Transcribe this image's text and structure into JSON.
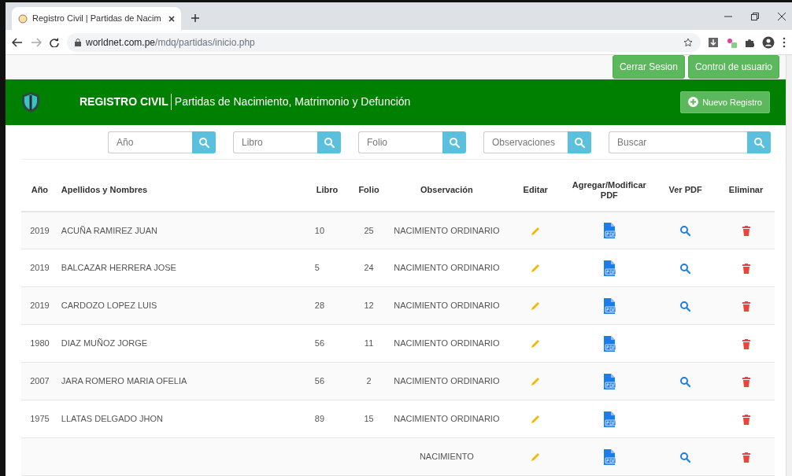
{
  "browser": {
    "tab_title": "Registro Civil | Partidas de Nacim",
    "url_host": "worldnet.com.pe",
    "url_path": "/mdq/partidas/inicio.php"
  },
  "top_buttons": [
    "Cerrar Sesion",
    "Control de usuario"
  ],
  "header": {
    "brand": "REGISTRO CIVIL",
    "subtitle": "Partidas de Nacimiento, Matrimonio y Defunción",
    "new_button": "Nuevo Registro"
  },
  "filters": [
    {
      "placeholder": "Año"
    },
    {
      "placeholder": "Libro"
    },
    {
      "placeholder": "Folio"
    },
    {
      "placeholder": "Observaciones"
    },
    {
      "placeholder": "Buscar"
    }
  ],
  "table": {
    "columns": [
      "Año",
      "Apellidos y Nombres",
      "Libro",
      "Folio",
      "Observación",
      "Editar",
      "Agregar/Modificar PDF",
      "Ver PDF",
      "Eliminar"
    ],
    "rows": [
      {
        "year": "2019",
        "name": "ACUÑA RAMIREZ JUAN",
        "libro": "10",
        "folio": "25",
        "observacion": "NACIMIENTO ORDINARIO",
        "viewable": true
      },
      {
        "year": "2019",
        "name": "BALCAZAR HERRERA JOSE",
        "libro": "5",
        "folio": "24",
        "observacion": "NACIMIENTO ORDINARIO",
        "viewable": true
      },
      {
        "year": "2019",
        "name": "CARDOZO LOPEZ LUIS",
        "libro": "28",
        "folio": "12",
        "observacion": "NACIMIENTO ORDINARIO",
        "viewable": true
      },
      {
        "year": "1980",
        "name": "DIAZ MUÑOZ JORGE",
        "libro": "56",
        "folio": "11",
        "observacion": "NACIMIENTO ORDINARIO",
        "viewable": false
      },
      {
        "year": "2007",
        "name": "JARA ROMERO MARIA OFELIA",
        "libro": "56",
        "folio": "2",
        "observacion": "NACIMIENTO ORDINARIO",
        "viewable": true
      },
      {
        "year": "1975",
        "name": "LLATAS DELGADO JHON",
        "libro": "89",
        "folio": "15",
        "observacion": "NACIMIENTO ORDINARIO",
        "viewable": false
      },
      {
        "observacion": "NACIMIENTO",
        "viewable": true
      }
    ]
  }
}
